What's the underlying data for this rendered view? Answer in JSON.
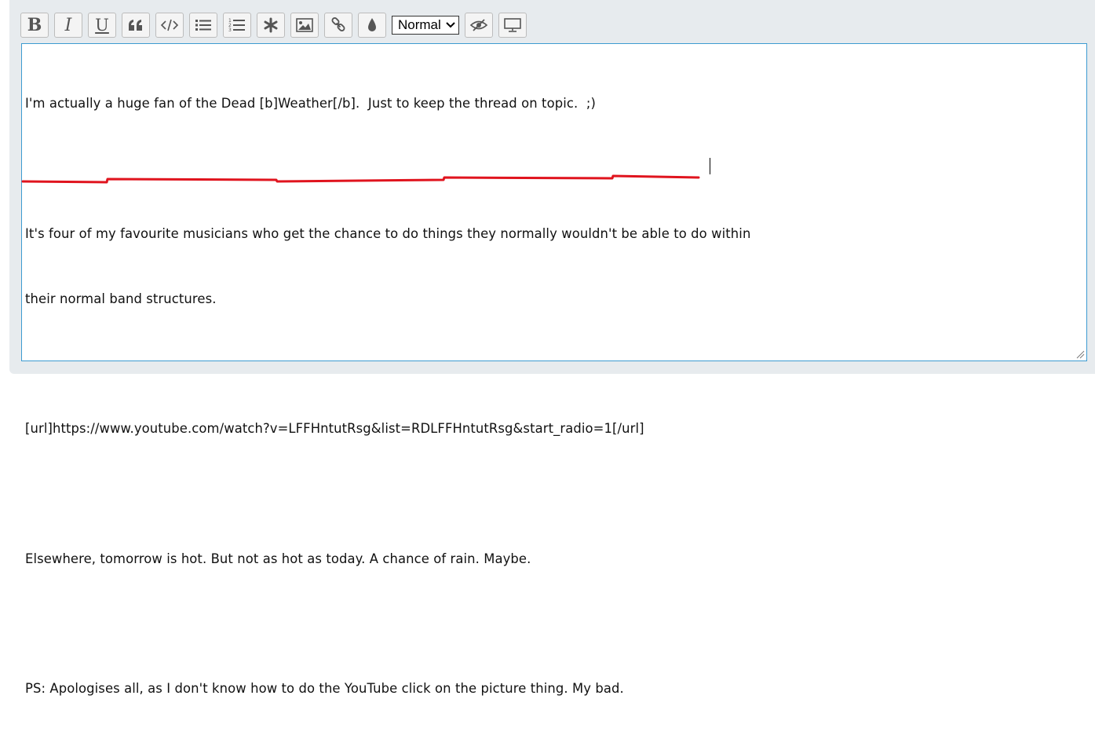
{
  "toolbar": {
    "buttons": [
      {
        "name": "bold",
        "glyph": "B"
      },
      {
        "name": "italic",
        "glyph": "I"
      },
      {
        "name": "underline",
        "glyph": "U"
      },
      {
        "name": "quote",
        "icon": "quote-icon"
      },
      {
        "name": "code",
        "icon": "code-icon"
      },
      {
        "name": "bullet-list",
        "icon": "bullet-list-icon"
      },
      {
        "name": "numbered-list",
        "icon": "numbered-list-icon"
      },
      {
        "name": "spoiler",
        "icon": "asterisk-icon"
      },
      {
        "name": "image",
        "icon": "image-icon"
      },
      {
        "name": "link",
        "icon": "link-icon"
      },
      {
        "name": "color",
        "icon": "droplet-icon"
      }
    ],
    "size_select": {
      "value": "Normal"
    },
    "right_buttons": [
      {
        "name": "hide-preview",
        "icon": "eye-slash-icon"
      },
      {
        "name": "preview",
        "icon": "monitor-icon"
      }
    ]
  },
  "editor": {
    "lines": [
      "I'm actually a huge fan of the Dead [b]Weather[/b].  Just to keep the thread on topic.  ;)",
      "",
      "It's four of my favourite musicians who get the chance to do things they normally wouldn't be able to do within",
      "their normal band structures.",
      "",
      "[url]https://www.youtube.com/watch?v=LFFHntutRsg&list=RDLFFHntutRsg&start_radio=1[/url]",
      "",
      "Elsewhere, tomorrow is hot. But not as hot as today. A chance of rain. Maybe.",
      "",
      "PS: Apologises all, as I don't know how to do the YouTube click on the picture thing. My bad."
    ]
  },
  "colors": {
    "panel_bg": "#e7ebee",
    "editor_border": "#3d9bd1",
    "annotation_red": "#e0141e"
  }
}
